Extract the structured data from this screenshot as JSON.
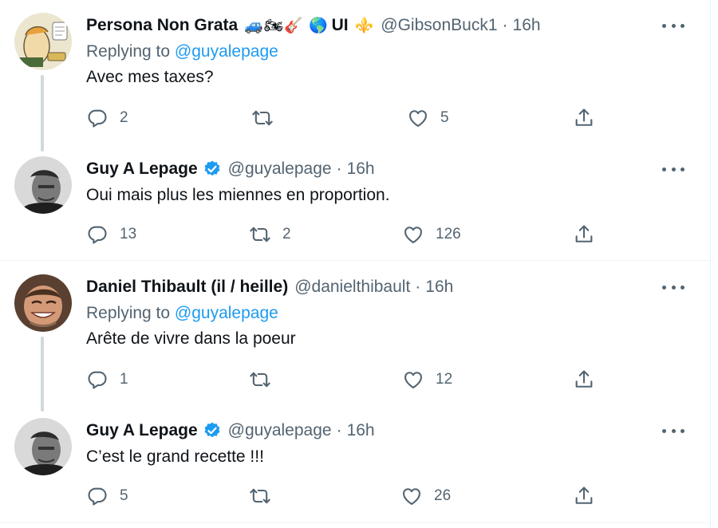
{
  "tweets": [
    {
      "name": "Persona Non Grata",
      "emojis": "🚙🏍🎸 🌎",
      "extra_label": "UI",
      "extra_emoji": "⚜️",
      "verified": false,
      "handle": "@GibsonBuck1",
      "dot": "·",
      "time": "16h",
      "replying_prefix": "Replying to",
      "replying_to": "@guyalepage",
      "text": "Avec mes taxes?",
      "replies": "2",
      "retweets": "",
      "likes": "5"
    },
    {
      "name": "Guy A Lepage",
      "verified": true,
      "handle": "@guyalepage",
      "dot": "·",
      "time": "16h",
      "text": "Oui mais plus les miennes en proportion.",
      "replies": "13",
      "retweets": "2",
      "likes": "126"
    },
    {
      "name": "Daniel Thibault (il / heille)",
      "verified": false,
      "handle": "@danielthibault",
      "dot": "·",
      "time": "16h",
      "replying_prefix": "Replying to",
      "replying_to": "@guyalepage",
      "text": "Arête de vivre dans la poeur",
      "replies": "1",
      "retweets": "",
      "likes": "12"
    },
    {
      "name": "Guy A Lepage",
      "verified": true,
      "handle": "@guyalepage",
      "dot": "·",
      "time": "16h",
      "text": "C’est le grand recette !!!",
      "replies": "5",
      "retweets": "",
      "likes": "26"
    }
  ],
  "colors": {
    "link": "#1d9bf0",
    "secondary": "#536471",
    "verified": "#1d9bf0",
    "thread_line": "#cfd9de"
  },
  "icons": [
    "reply-icon",
    "retweet-icon",
    "like-icon",
    "share-icon",
    "more-icon",
    "verified-icon"
  ]
}
